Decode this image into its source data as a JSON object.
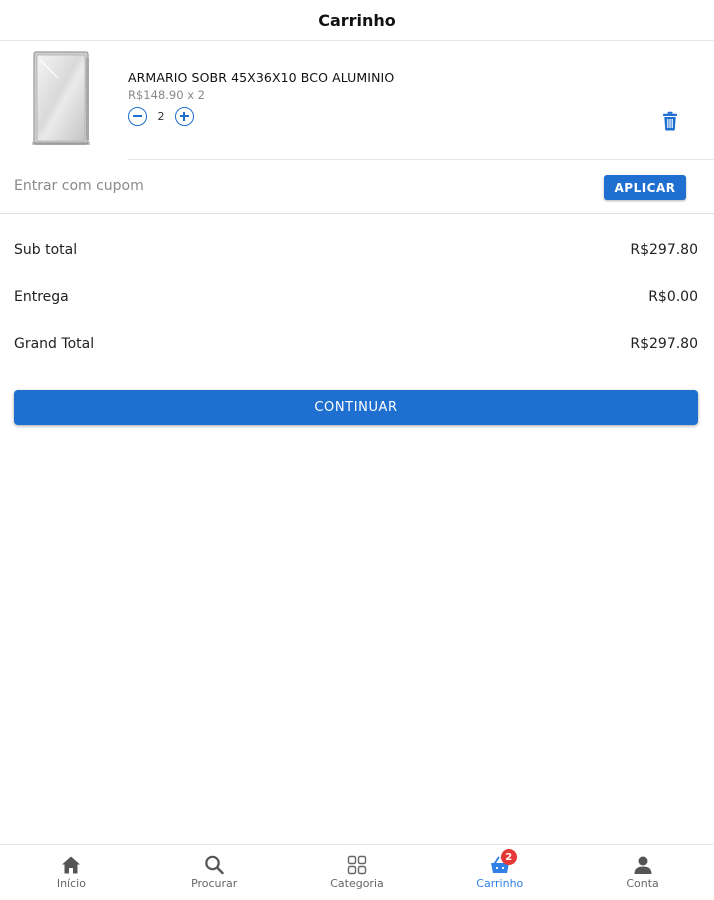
{
  "header": {
    "title": "Carrinho"
  },
  "cart": {
    "items": [
      {
        "name": "ARMARIO SOBR 45X36X10 BCO ALUMINIO",
        "price_line": "R$148.90 x 2",
        "quantity": "2",
        "image_icon": "mirror-cabinet-image"
      }
    ]
  },
  "coupon": {
    "placeholder": "Entrar com cupom",
    "value": "",
    "apply_label": "APLICAR"
  },
  "totals": {
    "subtotal_label": "Sub total",
    "subtotal_value": "R$297.80",
    "delivery_label": "Entrega",
    "delivery_value": "R$0.00",
    "grand_label": "Grand Total",
    "grand_value": "R$297.80"
  },
  "continue_label": "CONTINUAR",
  "nav": {
    "items": [
      {
        "label": "Início",
        "icon": "home-icon"
      },
      {
        "label": "Procurar",
        "icon": "search-icon"
      },
      {
        "label": "Categoria",
        "icon": "grid-icon"
      },
      {
        "label": "Carrinho",
        "icon": "basket-icon",
        "badge": "2",
        "active": true
      },
      {
        "label": "Conta",
        "icon": "user-icon"
      }
    ]
  },
  "colors": {
    "primary": "#1e6fcf",
    "active_nav": "#2f7fe6",
    "badge": "#e53935"
  }
}
